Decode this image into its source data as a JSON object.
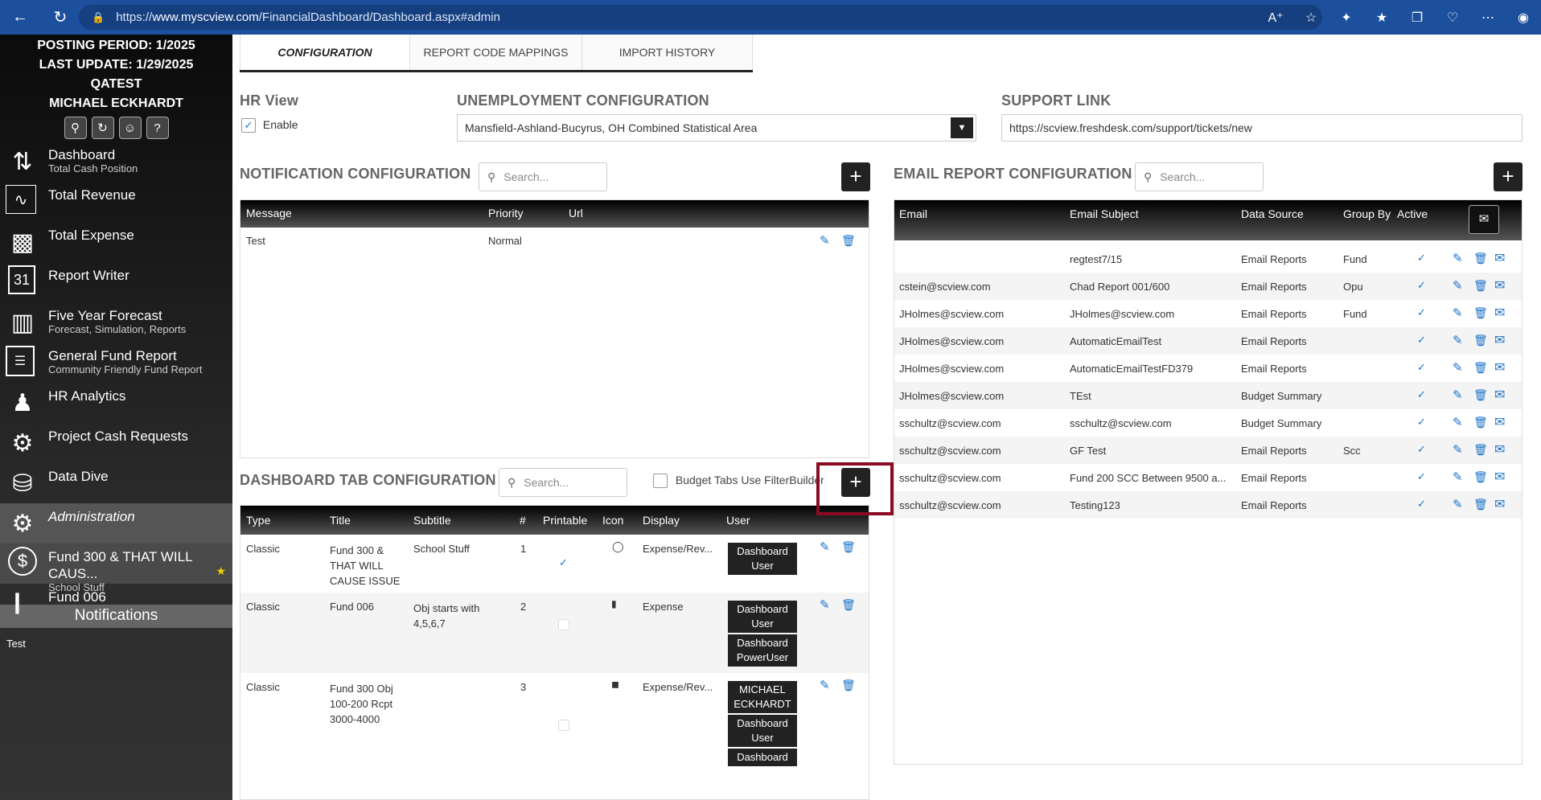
{
  "browser": {
    "url_prefix": "https://",
    "url_domain": "www.myscview.com",
    "url_path": "/FinancialDashboard/Dashboard.aspx#admin"
  },
  "sidebar": {
    "posting_period": "POSTING PERIOD: 1/2025",
    "last_update": "LAST UPDATE: 1/29/2025",
    "org": "QATEST",
    "user": "MICHAEL ECKHARDT",
    "items": [
      {
        "label": "Dashboard",
        "sub": "Total Cash Position"
      },
      {
        "label": "Total Revenue",
        "sub": ""
      },
      {
        "label": "Total Expense",
        "sub": ""
      },
      {
        "label": "Report Writer",
        "sub": ""
      },
      {
        "label": "Five Year Forecast",
        "sub": "Forecast, Simulation, Reports"
      },
      {
        "label": "General Fund Report",
        "sub": "Community Friendly Fund Report"
      },
      {
        "label": "HR Analytics",
        "sub": ""
      },
      {
        "label": "Project Cash Requests",
        "sub": ""
      },
      {
        "label": "Data Dive",
        "sub": ""
      },
      {
        "label": "Administration",
        "sub": ""
      },
      {
        "label": "Fund 300 & THAT WILL CAUS...",
        "sub": "School Stuff"
      },
      {
        "label": "Fund 006",
        "sub": ""
      }
    ],
    "calendar_day": "31",
    "notifications_title": "Notifications",
    "notification_text": "Test"
  },
  "tabs": [
    "CONFIGURATION",
    "REPORT CODE MAPPINGS",
    "IMPORT HISTORY"
  ],
  "hr_view": {
    "title": "HR View",
    "enable_label": "Enable"
  },
  "unemployment": {
    "title": "UNEMPLOYMENT CONFIGURATION",
    "value": "Mansfield-Ashland-Bucyrus, OH Combined Statistical Area"
  },
  "support": {
    "title": "SUPPORT LINK",
    "value": "https://scview.freshdesk.com/support/tickets/new"
  },
  "search_placeholder": "Search...",
  "notification_config": {
    "title": "NOTIFICATION CONFIGURATION",
    "columns": [
      "Message",
      "Priority",
      "Url"
    ],
    "rows": [
      {
        "message": "Test",
        "priority": "Normal",
        "url": ""
      }
    ]
  },
  "email_config": {
    "title": "EMAIL REPORT CONFIGURATION",
    "columns": [
      "Email",
      "Email Subject",
      "Data Source",
      "Group By",
      "Active"
    ],
    "rows": [
      {
        "email": "",
        "subject": "regtest7/15",
        "source": "Email Reports",
        "group": "Fund"
      },
      {
        "email": "cstein@scview.com",
        "subject": "Chad Report 001/600",
        "source": "Email Reports",
        "group": "Opu"
      },
      {
        "email": "JHolmes@scview.com",
        "subject": "JHolmes@scview.com",
        "source": "Email Reports",
        "group": "Fund"
      },
      {
        "email": "JHolmes@scview.com",
        "subject": "AutomaticEmailTest",
        "source": "Email Reports",
        "group": ""
      },
      {
        "email": "JHolmes@scview.com",
        "subject": "AutomaticEmailTestFD379",
        "source": "Email Reports",
        "group": ""
      },
      {
        "email": "JHolmes@scview.com",
        "subject": "TEst",
        "source": "Budget Summary",
        "group": ""
      },
      {
        "email": "sschultz@scview.com",
        "subject": "sschultz@scview.com",
        "source": "Budget Summary",
        "group": ""
      },
      {
        "email": "sschultz@scview.com",
        "subject": "GF Test",
        "source": "Email Reports",
        "group": "Scc"
      },
      {
        "email": "sschultz@scview.com",
        "subject": "Fund 200 SCC Between 9500 a...",
        "source": "Email Reports",
        "group": ""
      },
      {
        "email": "sschultz@scview.com",
        "subject": "Testing123",
        "source": "Email Reports",
        "group": ""
      }
    ]
  },
  "dashboard_tab_config": {
    "title": "DASHBOARD TAB CONFIGURATION",
    "filter_label": "Budget Tabs Use FilterBuilder",
    "columns": [
      "Type",
      "Title",
      "Subtitle",
      "#",
      "Printable",
      "Icon",
      "Display",
      "User"
    ],
    "rows": [
      {
        "type": "Classic",
        "title": "Fund 300 & THAT WILL CAUSE ISSUE",
        "subtitle": "School Stuff",
        "num": "1",
        "display": "Expense/Rev...",
        "users": [
          "Dashboard User"
        ]
      },
      {
        "type": "Classic",
        "title": "Fund 006",
        "subtitle": "Obj starts with 4,5,6,7",
        "num": "2",
        "display": "Expense",
        "users": [
          "Dashboard User",
          "Dashboard PowerUser"
        ]
      },
      {
        "type": "Classic",
        "title": "Fund 300 Obj 100-200 Rcpt 3000-4000",
        "subtitle": "",
        "num": "3",
        "display": "Expense/Rev...",
        "users": [
          "MICHAEL ECKHARDT",
          "Dashboard User",
          "Dashboard"
        ]
      }
    ]
  },
  "colors": {
    "accent": "#1a73c8",
    "header_dark": "#222222",
    "highlight": "#8b0a24",
    "browser": "#1c4f9c"
  }
}
